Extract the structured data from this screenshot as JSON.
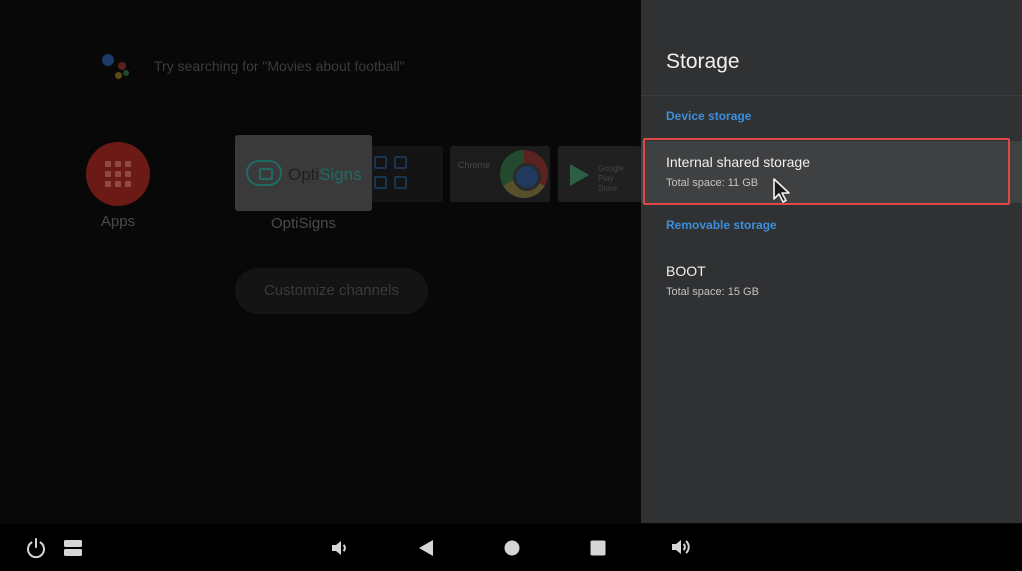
{
  "launcher": {
    "search_hint": "Try searching for \"Movies about football\"",
    "apps_label": "Apps",
    "tiles": {
      "optisigns_text_a": "Opti",
      "optisigns_text_b": "Signs",
      "optisigns_label": "OptiSigns",
      "chrome_label": "Chrome",
      "play_label_line1": "Google Play",
      "play_label_line2": "Store"
    },
    "customize_label": "Customize channels"
  },
  "panel": {
    "title": "Storage",
    "sections": [
      {
        "label": "Device storage",
        "items": [
          {
            "title": "Internal shared storage",
            "subtitle": "Total space: 11 GB",
            "focused": true
          }
        ]
      },
      {
        "label": "Removable storage",
        "items": [
          {
            "title": "BOOT",
            "subtitle": "Total space: 15 GB",
            "focused": false
          }
        ]
      }
    ]
  },
  "navbar": {
    "icons": [
      "power-icon",
      "recents-list-icon",
      "volume-down-icon",
      "back-icon",
      "home-icon",
      "overview-icon",
      "volume-up-icon"
    ]
  },
  "colors": {
    "accent_blue": "#3d8fdc",
    "panel_bg": "#2f3133",
    "focused_item_bg": "#3e4042",
    "annotation_red": "#e04848"
  }
}
